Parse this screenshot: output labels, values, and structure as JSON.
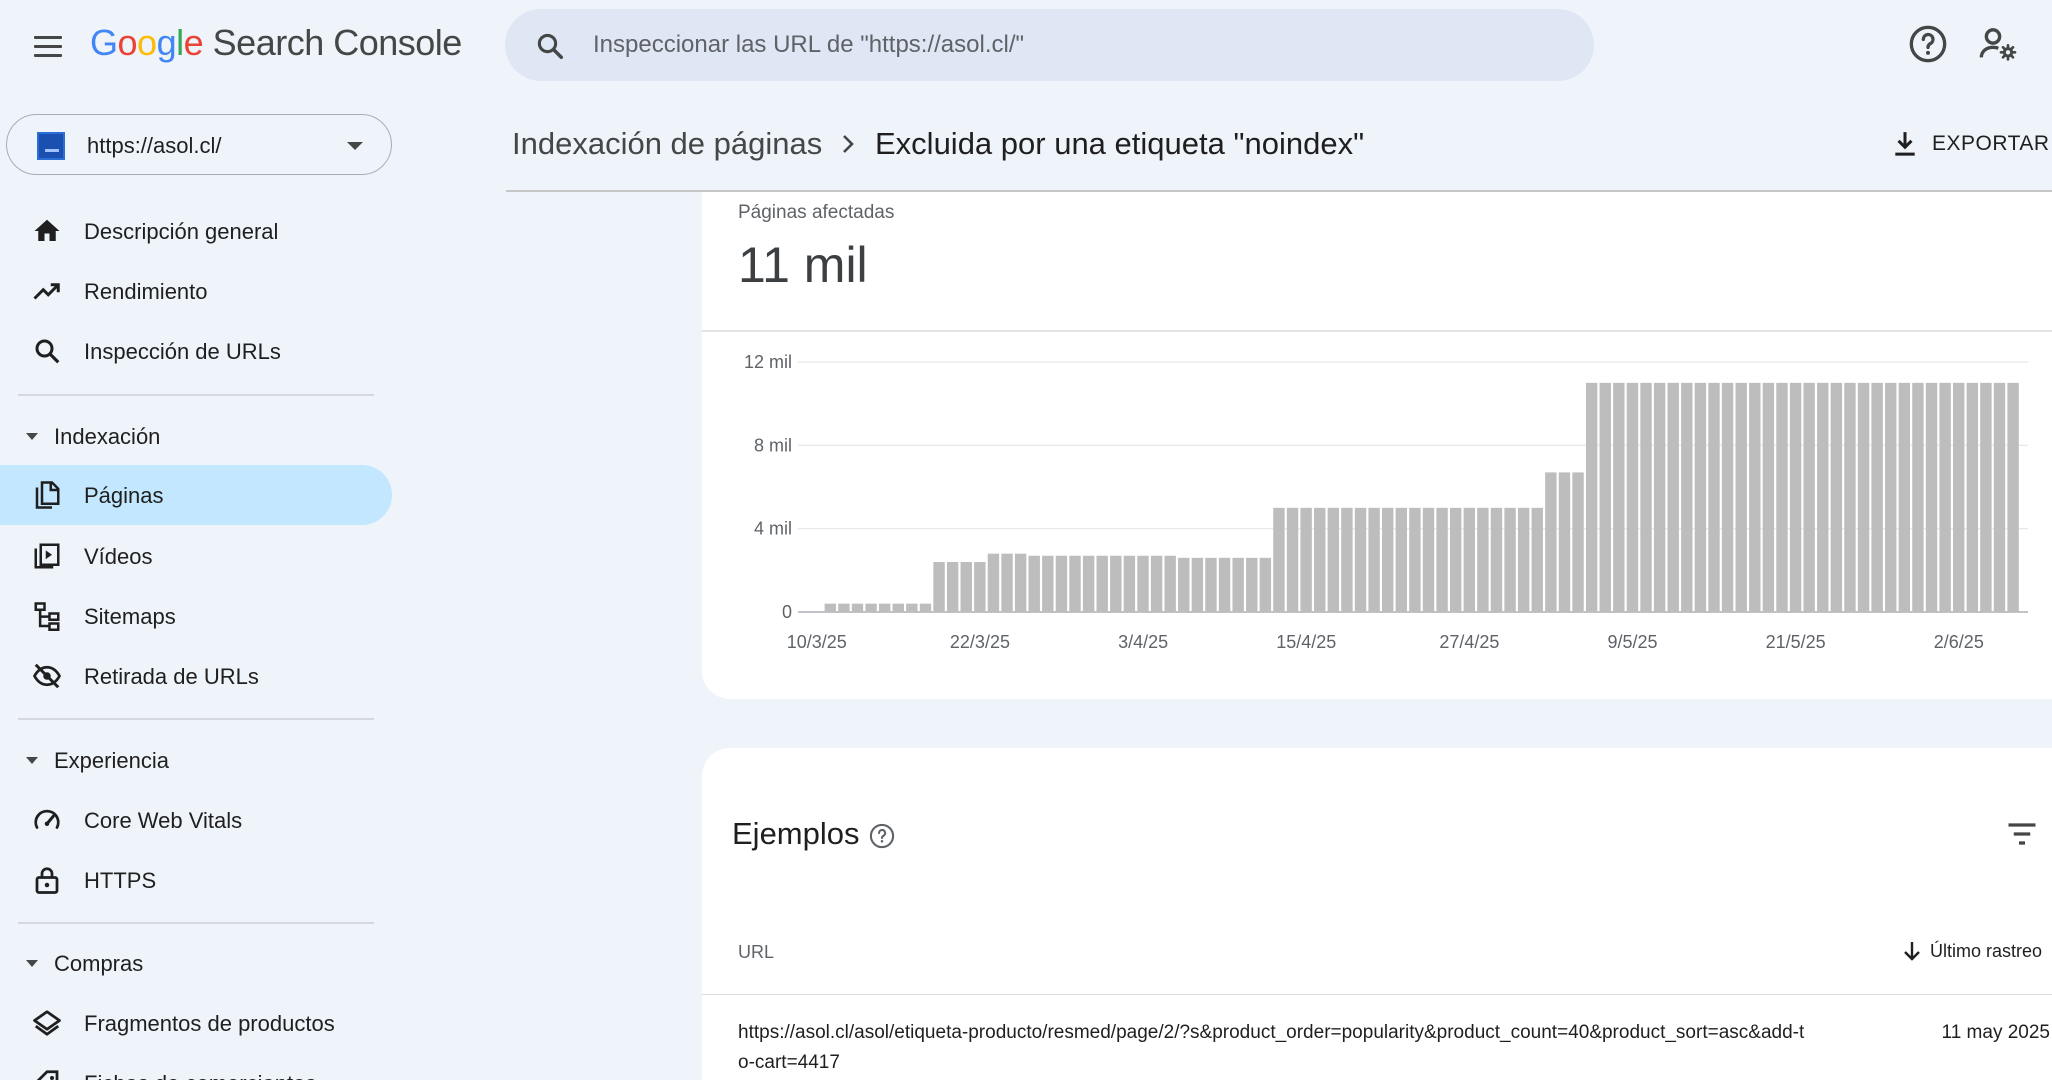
{
  "app": {
    "logo_google": [
      "G",
      "o",
      "o",
      "g",
      "l",
      "e"
    ],
    "logo_product": "Search Console"
  },
  "search": {
    "placeholder": "Inspeccionar las URL de \"https://asol.cl/\""
  },
  "property": {
    "url": "https://asol.cl/"
  },
  "sidebar": {
    "items_top": [
      {
        "label": "Descripción general",
        "icon": "home-icon"
      },
      {
        "label": "Rendimiento",
        "icon": "trending-up-icon"
      },
      {
        "label": "Inspección de URLs",
        "icon": "search-icon"
      }
    ],
    "sections": [
      {
        "label": "Indexación",
        "items": [
          {
            "label": "Páginas",
            "icon": "pages-icon",
            "active": true
          },
          {
            "label": "Vídeos",
            "icon": "video-icon"
          },
          {
            "label": "Sitemaps",
            "icon": "sitemap-icon"
          },
          {
            "label": "Retirada de URLs",
            "icon": "visibility-off-icon"
          }
        ]
      },
      {
        "label": "Experiencia",
        "items": [
          {
            "label": "Core Web Vitals",
            "icon": "speed-icon"
          },
          {
            "label": "HTTPS",
            "icon": "lock-icon"
          }
        ]
      },
      {
        "label": "Compras",
        "items": [
          {
            "label": "Fragmentos de productos",
            "icon": "layers-icon"
          },
          {
            "label": "Fichas de comerciantes",
            "icon": "tag-icon"
          }
        ]
      }
    ]
  },
  "header": {
    "breadcrumb_root": "Indexación de páginas",
    "breadcrumb_current": "Excluida por una etiqueta \"noindex\"",
    "export_label": "EXPORTAR"
  },
  "metric": {
    "label": "Páginas afectadas",
    "value": "11 mil"
  },
  "chart_data": {
    "type": "bar",
    "color": "#bdbdbd",
    "ylim": [
      0,
      12000
    ],
    "yticks": [
      0,
      4000,
      8000,
      12000
    ],
    "ytick_labels": [
      "0",
      "4 mil",
      "8 mil",
      "12 mil"
    ],
    "xtick_labels": [
      "10/3/25",
      "22/3/25",
      "3/4/25",
      "15/4/25",
      "27/4/25",
      "9/5/25",
      "21/5/25",
      "2/6/25"
    ],
    "xtick_positions": [
      0,
      12,
      24,
      36,
      48,
      60,
      72,
      84
    ],
    "values": [
      0,
      400,
      400,
      400,
      400,
      400,
      400,
      400,
      400,
      2400,
      2400,
      2400,
      2400,
      2800,
      2800,
      2800,
      2700,
      2700,
      2700,
      2700,
      2700,
      2700,
      2700,
      2700,
      2700,
      2700,
      2700,
      2600,
      2600,
      2600,
      2600,
      2600,
      2600,
      2600,
      5000,
      5000,
      5000,
      5000,
      5000,
      5000,
      5000,
      5000,
      5000,
      5000,
      5000,
      5000,
      5000,
      5000,
      5000,
      5000,
      5000,
      5000,
      5000,
      5000,
      6700,
      6700,
      6700,
      11000,
      11000,
      11000,
      11000,
      11000,
      11000,
      11000,
      11000,
      11000,
      11000,
      11000,
      11000,
      11000,
      11000,
      11000,
      11000,
      11000,
      11000,
      11000,
      11000,
      11000,
      11000,
      11000,
      11000,
      11000,
      11000,
      11000,
      11000,
      11000,
      11000,
      11000,
      11000
    ]
  },
  "examples": {
    "title": "Ejemplos",
    "col_url": "URL",
    "col_last": "Último rastreo",
    "rows": [
      {
        "url": "https://asol.cl/asol/etiqueta-producto/resmed/page/2/?s&product_order=popularity&product_count=40&product_sort=asc&add-to-cart=4417",
        "date": "11 may 2025"
      }
    ]
  }
}
